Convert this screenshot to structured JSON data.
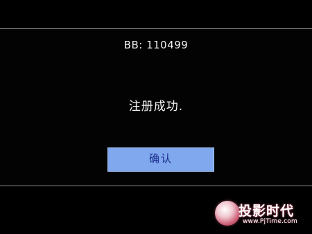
{
  "dialog": {
    "code_label": "BB:",
    "code_value": "110499",
    "message": "注册成功.",
    "confirm_label": "确认"
  },
  "watermark": {
    "title": "投影时代",
    "url": "www.PjTime.com"
  },
  "colors": {
    "background": "#000000",
    "text": "#f2f2f2",
    "button_fill": "#7fa8ee",
    "button_text": "#1a2a8a",
    "divider": "#8a8a8a"
  }
}
